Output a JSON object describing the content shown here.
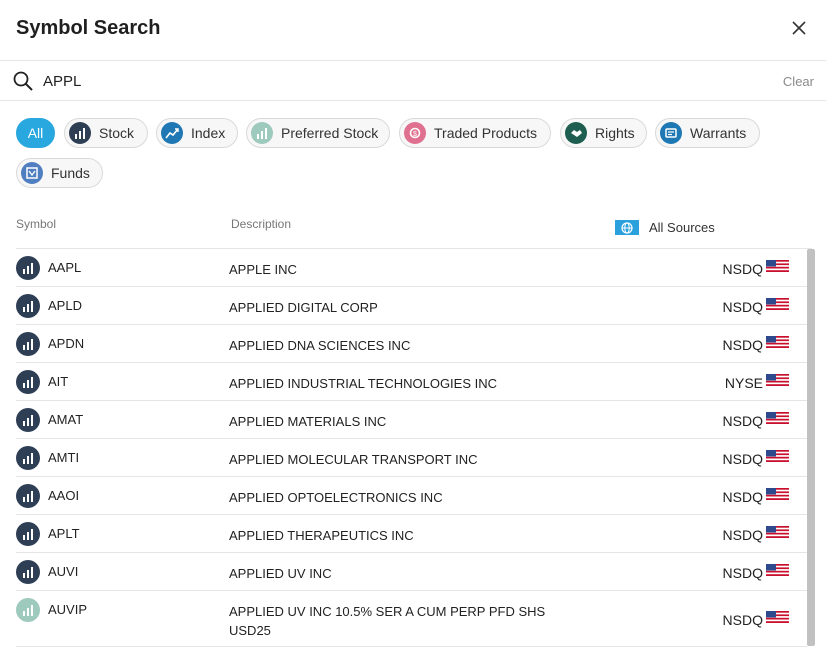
{
  "header": {
    "title": "Symbol Search"
  },
  "search": {
    "value": "APPL",
    "clear_label": "Clear"
  },
  "filters": [
    {
      "label": "All",
      "icon": "",
      "color": "#29a7df"
    },
    {
      "label": "Stock",
      "icon": "stock-chart-icon",
      "color": "#2e3e55"
    },
    {
      "label": "Index",
      "icon": "index-trend-icon",
      "color": "#1f77b4"
    },
    {
      "label": "Preferred Stock",
      "icon": "preferred-stock-icon",
      "color": "#9ec9bd"
    },
    {
      "label": "Traded Products",
      "icon": "traded-products-icon",
      "color": "#e0708f"
    },
    {
      "label": "Rights",
      "icon": "rights-handshake-icon",
      "color": "#1e5e50"
    },
    {
      "label": "Warrants",
      "icon": "warrants-icon",
      "color": "#1d78b3"
    },
    {
      "label": "Funds",
      "icon": "funds-icon",
      "color": "#4f7fc0"
    }
  ],
  "table": {
    "headers": {
      "symbol": "Symbol",
      "description": "Description",
      "sources": "All Sources"
    },
    "rows": [
      {
        "symbol": "AAPL",
        "description": "APPLE INC",
        "exchange": "NSDQ",
        "type": "stock"
      },
      {
        "symbol": "APLD",
        "description": "APPLIED DIGITAL CORP",
        "exchange": "NSDQ",
        "type": "stock"
      },
      {
        "symbol": "APDN",
        "description": "APPLIED DNA SCIENCES INC",
        "exchange": "NSDQ",
        "type": "stock"
      },
      {
        "symbol": "AIT",
        "description": "APPLIED INDUSTRIAL TECHNOLOGIES INC",
        "exchange": "NYSE",
        "type": "stock"
      },
      {
        "symbol": "AMAT",
        "description": "APPLIED MATERIALS INC",
        "exchange": "NSDQ",
        "type": "stock"
      },
      {
        "symbol": "AMTI",
        "description": "APPLIED MOLECULAR TRANSPORT INC",
        "exchange": "NSDQ",
        "type": "stock"
      },
      {
        "symbol": "AAOI",
        "description": "APPLIED OPTOELECTRONICS INC",
        "exchange": "NSDQ",
        "type": "stock"
      },
      {
        "symbol": "APLT",
        "description": "APPLIED THERAPEUTICS INC",
        "exchange": "NSDQ",
        "type": "stock"
      },
      {
        "symbol": "AUVI",
        "description": "APPLIED UV INC",
        "exchange": "NSDQ",
        "type": "stock"
      },
      {
        "symbol": "AUVIP",
        "description": "APPLIED UV INC 10.5% SER A CUM PERP PFD SHS USD25",
        "exchange": "NSDQ",
        "type": "preferred"
      }
    ]
  }
}
